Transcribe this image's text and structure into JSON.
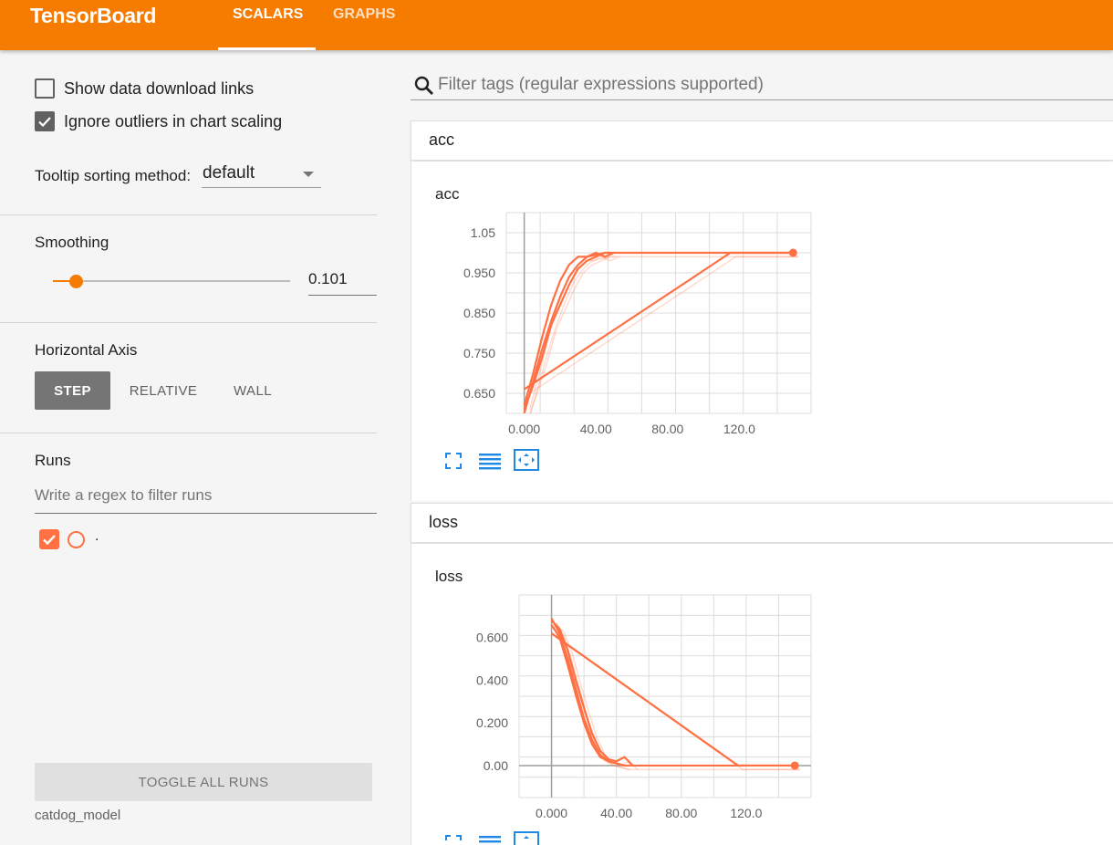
{
  "header": {
    "brand": "TensorBoard",
    "tabs": [
      {
        "label": "SCALARS",
        "active": true
      },
      {
        "label": "GRAPHS",
        "active": false
      }
    ],
    "accent_color": "#f57c00"
  },
  "sidebar": {
    "show_download_links": {
      "label": "Show data download links",
      "checked": false
    },
    "ignore_outliers": {
      "label": "Ignore outliers in chart scaling",
      "checked": true
    },
    "tooltip_sorting": {
      "label": "Tooltip sorting method:",
      "value": "default"
    },
    "smoothing": {
      "title": "Smoothing",
      "value": "0.101",
      "level": 0.101
    },
    "horizontal_axis": {
      "title": "Horizontal Axis",
      "options": [
        "STEP",
        "RELATIVE",
        "WALL"
      ],
      "selected": "STEP"
    },
    "runs": {
      "title": "Runs",
      "filter_placeholder": "Write a regex to filter runs",
      "items": [
        {
          "name": ".",
          "checked": true,
          "color": "#ff7043"
        }
      ],
      "toggle_label": "TOGGLE ALL RUNS",
      "logdir": "catdog_model"
    }
  },
  "main": {
    "filter_placeholder": "Filter tags (regular expressions supported)",
    "categories": [
      {
        "name": "acc",
        "card_title": "acc"
      },
      {
        "name": "loss",
        "card_title": "loss"
      }
    ]
  },
  "chart_data": [
    {
      "type": "line",
      "title": "acc",
      "xlabel": "",
      "ylabel": "",
      "xlim": [
        -10,
        160
      ],
      "ylim": [
        0.6,
        1.1
      ],
      "x_ticks": [
        "0.000",
        "40.00",
        "80.00",
        "120.0"
      ],
      "x_tick_values": [
        0,
        40,
        80,
        120
      ],
      "y_ticks": [
        "1.05",
        "0.950",
        "0.850",
        "0.750",
        "0.650"
      ],
      "y_tick_values": [
        1.05,
        0.95,
        0.85,
        0.75,
        0.65
      ],
      "grid": true,
      "color": "#ff7043",
      "series": [
        {
          "x": [
            0,
            5,
            10,
            15,
            20,
            25,
            30,
            35,
            40,
            45,
            50,
            150
          ],
          "y": [
            0.6,
            0.68,
            0.76,
            0.83,
            0.89,
            0.94,
            0.97,
            0.99,
            0.995,
            1.0,
            1.0,
            1.0
          ]
        },
        {
          "x": [
            0,
            5,
            10,
            15,
            20,
            25,
            30,
            35,
            40,
            45,
            50
          ],
          "y": [
            0.62,
            0.7,
            0.79,
            0.87,
            0.93,
            0.97,
            0.99,
            0.99,
            1.0,
            0.99,
            1.0
          ]
        },
        {
          "x": [
            0,
            5,
            10,
            15,
            20,
            25,
            30,
            35,
            40,
            45,
            48
          ],
          "y": [
            0.61,
            0.67,
            0.74,
            0.82,
            0.87,
            0.92,
            0.96,
            0.98,
            0.99,
            1.0,
            1.0
          ]
        },
        {
          "x": [
            0,
            115,
            150
          ],
          "y": [
            0.66,
            1.0,
            1.0
          ]
        }
      ],
      "end_point": {
        "x": 150,
        "y": 1.0
      }
    },
    {
      "type": "line",
      "title": "loss",
      "xlabel": "",
      "ylabel": "",
      "xlim": [
        -20,
        160
      ],
      "ylim": [
        -0.15,
        0.8
      ],
      "x_ticks": [
        "0.000",
        "40.00",
        "80.00",
        "120.0"
      ],
      "x_tick_values": [
        0,
        40,
        80,
        120
      ],
      "y_ticks": [
        "0.600",
        "0.400",
        "0.200",
        "0.00"
      ],
      "y_tick_values": [
        0.6,
        0.4,
        0.2,
        0.0
      ],
      "grid": true,
      "color": "#ff7043",
      "series": [
        {
          "x": [
            0,
            5,
            10,
            15,
            20,
            25,
            30,
            35,
            40,
            45,
            50,
            150
          ],
          "y": [
            0.69,
            0.62,
            0.5,
            0.36,
            0.22,
            0.12,
            0.05,
            0.02,
            0.01,
            0.0,
            0.0,
            0.0
          ]
        },
        {
          "x": [
            0,
            5,
            10,
            15,
            20,
            25,
            30,
            35,
            40,
            45
          ],
          "y": [
            0.66,
            0.6,
            0.47,
            0.33,
            0.2,
            0.1,
            0.04,
            0.02,
            0.01,
            0.0
          ]
        },
        {
          "x": [
            0,
            5,
            10,
            15,
            20,
            25,
            30,
            35,
            40,
            45,
            50
          ],
          "y": [
            0.68,
            0.64,
            0.54,
            0.4,
            0.27,
            0.15,
            0.07,
            0.03,
            0.02,
            0.04,
            0.0
          ]
        },
        {
          "x": [
            0,
            115,
            150
          ],
          "y": [
            0.62,
            0.0,
            0.0
          ]
        }
      ],
      "end_point": {
        "x": 150,
        "y": 0.0
      }
    }
  ]
}
